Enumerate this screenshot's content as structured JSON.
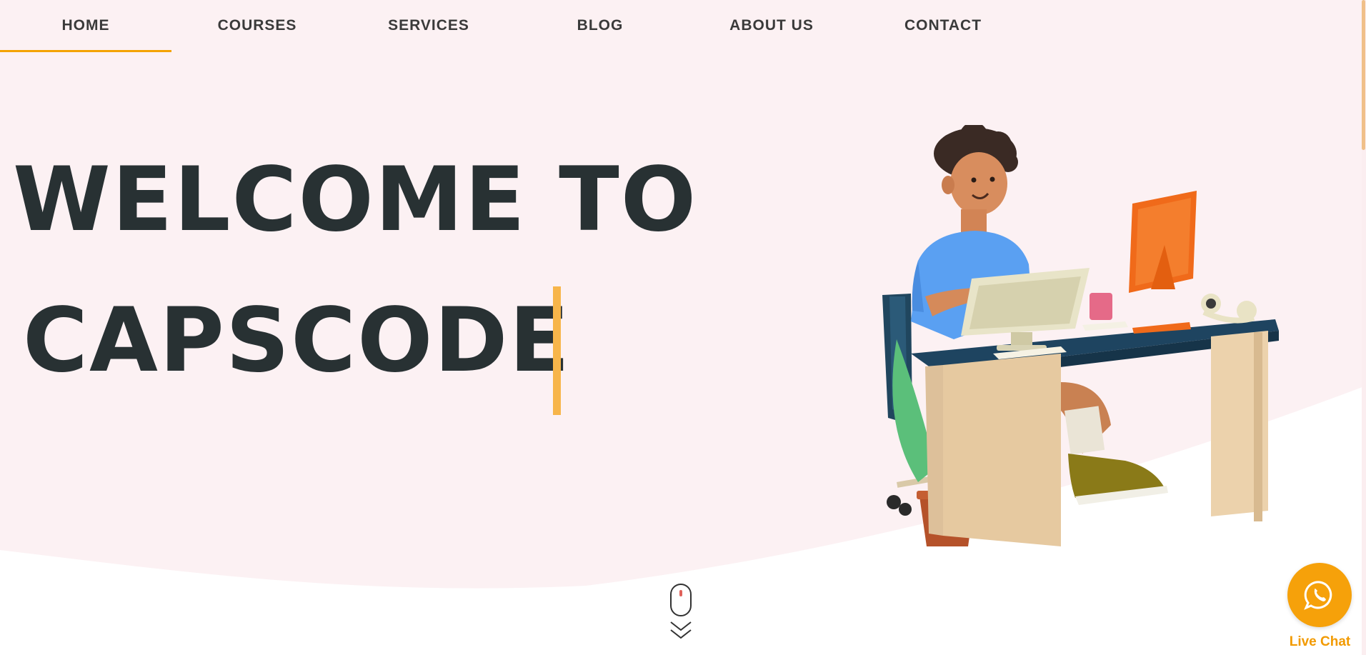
{
  "nav": {
    "items": [
      {
        "label": "HOME",
        "active": true
      },
      {
        "label": "COURSES",
        "active": false
      },
      {
        "label": "SERVICES",
        "active": false
      },
      {
        "label": "BLOG",
        "active": false
      },
      {
        "label": "ABOUT US",
        "active": false
      },
      {
        "label": "CONTACT",
        "active": false
      }
    ]
  },
  "hero": {
    "line1": "WELCOME TO",
    "line2": "CAPSCODE"
  },
  "chat": {
    "label": "Live Chat",
    "icon": "whatsapp-icon"
  },
  "scroll": {
    "icon": "mouse-scroll-icon"
  },
  "colors": {
    "hero_background": "#fcf1f3",
    "accent": "#f4a300",
    "caret": "#f7b54a",
    "headline": "#283133",
    "chat_button": "#f6a10a"
  }
}
